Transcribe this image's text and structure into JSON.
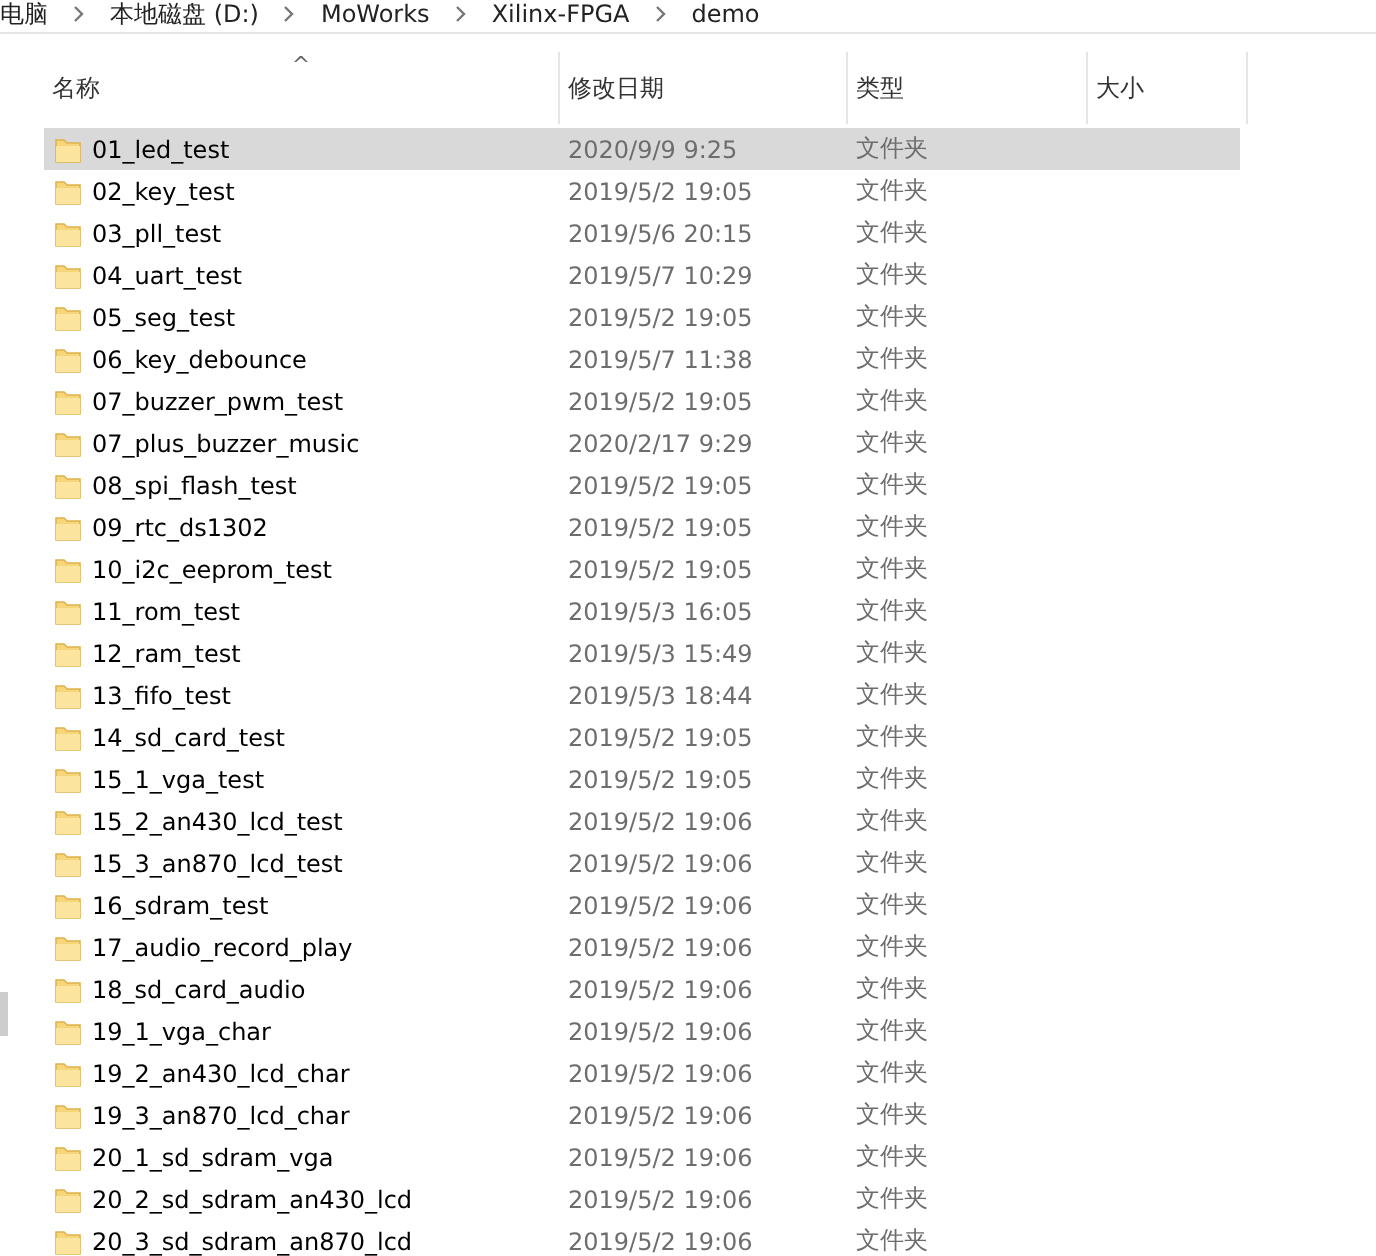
{
  "breadcrumb": [
    "电脑",
    "本地磁盘 (D:)",
    "MoWorks",
    "Xilinx-FPGA",
    "demo"
  ],
  "columns": [
    {
      "label": "名称",
      "sorted": true
    },
    {
      "label": "修改日期",
      "sorted": false
    },
    {
      "label": "类型",
      "sorted": false
    },
    {
      "label": "大小",
      "sorted": false
    }
  ],
  "sort_indicator": "^",
  "rows": [
    {
      "name": "01_led_test",
      "modified": "2020/9/9 9:25",
      "type": "文件夹",
      "selected": true
    },
    {
      "name": "02_key_test",
      "modified": "2019/5/2 19:05",
      "type": "文件夹",
      "selected": false
    },
    {
      "name": "03_pll_test",
      "modified": "2019/5/6 20:15",
      "type": "文件夹",
      "selected": false
    },
    {
      "name": "04_uart_test",
      "modified": "2019/5/7 10:29",
      "type": "文件夹",
      "selected": false
    },
    {
      "name": "05_seg_test",
      "modified": "2019/5/2 19:05",
      "type": "文件夹",
      "selected": false
    },
    {
      "name": "06_key_debounce",
      "modified": "2019/5/7 11:38",
      "type": "文件夹",
      "selected": false
    },
    {
      "name": "07_buzzer_pwm_test",
      "modified": "2019/5/2 19:05",
      "type": "文件夹",
      "selected": false
    },
    {
      "name": "07_plus_buzzer_music",
      "modified": "2020/2/17 9:29",
      "type": "文件夹",
      "selected": false
    },
    {
      "name": "08_spi_flash_test",
      "modified": "2019/5/2 19:05",
      "type": "文件夹",
      "selected": false
    },
    {
      "name": "09_rtc_ds1302",
      "modified": "2019/5/2 19:05",
      "type": "文件夹",
      "selected": false
    },
    {
      "name": "10_i2c_eeprom_test",
      "modified": "2019/5/2 19:05",
      "type": "文件夹",
      "selected": false
    },
    {
      "name": "11_rom_test",
      "modified": "2019/5/3 16:05",
      "type": "文件夹",
      "selected": false
    },
    {
      "name": "12_ram_test",
      "modified": "2019/5/3 15:49",
      "type": "文件夹",
      "selected": false
    },
    {
      "name": "13_fifo_test",
      "modified": "2019/5/3 18:44",
      "type": "文件夹",
      "selected": false
    },
    {
      "name": "14_sd_card_test",
      "modified": "2019/5/2 19:05",
      "type": "文件夹",
      "selected": false
    },
    {
      "name": "15_1_vga_test",
      "modified": "2019/5/2 19:05",
      "type": "文件夹",
      "selected": false
    },
    {
      "name": "15_2_an430_lcd_test",
      "modified": "2019/5/2 19:06",
      "type": "文件夹",
      "selected": false
    },
    {
      "name": "15_3_an870_lcd_test",
      "modified": "2019/5/2 19:06",
      "type": "文件夹",
      "selected": false
    },
    {
      "name": "16_sdram_test",
      "modified": "2019/5/2 19:06",
      "type": "文件夹",
      "selected": false
    },
    {
      "name": "17_audio_record_play",
      "modified": "2019/5/2 19:06",
      "type": "文件夹",
      "selected": false
    },
    {
      "name": "18_sd_card_audio",
      "modified": "2019/5/2 19:06",
      "type": "文件夹",
      "selected": false
    },
    {
      "name": "19_1_vga_char",
      "modified": "2019/5/2 19:06",
      "type": "文件夹",
      "selected": false
    },
    {
      "name": "19_2_an430_lcd_char",
      "modified": "2019/5/2 19:06",
      "type": "文件夹",
      "selected": false
    },
    {
      "name": "19_3_an870_lcd_char",
      "modified": "2019/5/2 19:06",
      "type": "文件夹",
      "selected": false
    },
    {
      "name": "20_1_sd_sdram_vga",
      "modified": "2019/5/2 19:06",
      "type": "文件夹",
      "selected": false
    },
    {
      "name": "20_2_sd_sdram_an430_lcd",
      "modified": "2019/5/2 19:06",
      "type": "文件夹",
      "selected": false
    },
    {
      "name": "20_3_sd_sdram_an870_lcd",
      "modified": "2019/5/2 19:06",
      "type": "文件夹",
      "selected": false
    }
  ]
}
